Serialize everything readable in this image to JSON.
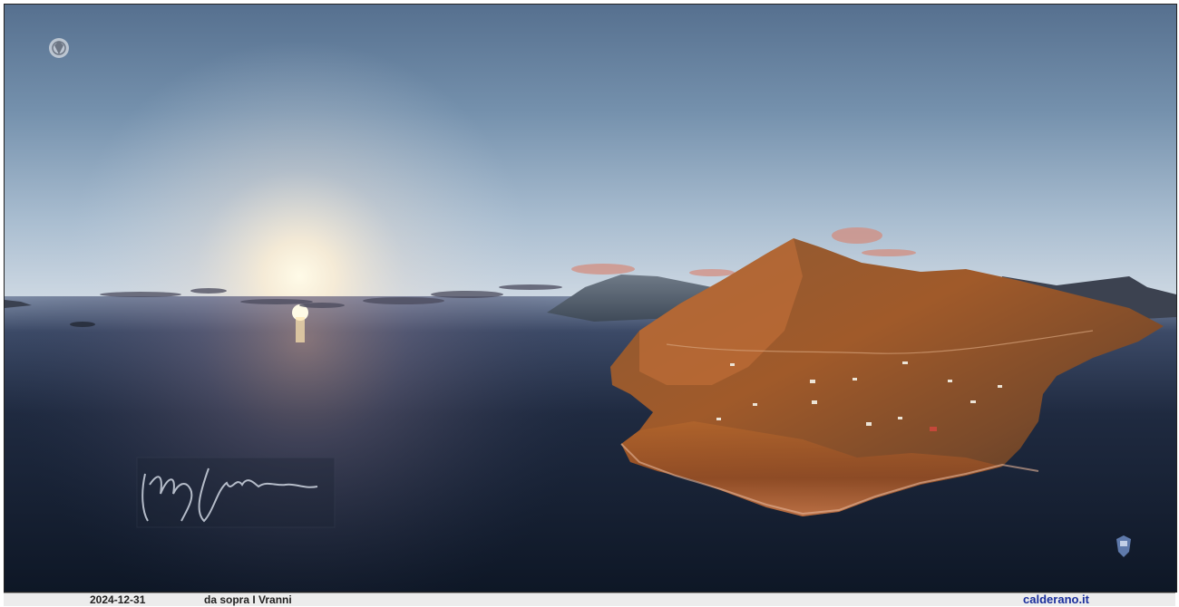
{
  "caption": {
    "date": "2024-12-31",
    "title": "da sopra I Vranni",
    "site": "calderano.it"
  },
  "image": {
    "logo_icon": "crest-icon",
    "signature_icon": "signature-icon",
    "small_logo_icon": "crest-small-icon",
    "colors": {
      "sky_top": "#5a7596",
      "sky_horizon": "#c9d6e2",
      "sea_dark": "#121d2e",
      "sun_glow": "#fff6dc",
      "mountain_lit": "#c06a2c",
      "site_link": "#1a2f9c"
    }
  }
}
